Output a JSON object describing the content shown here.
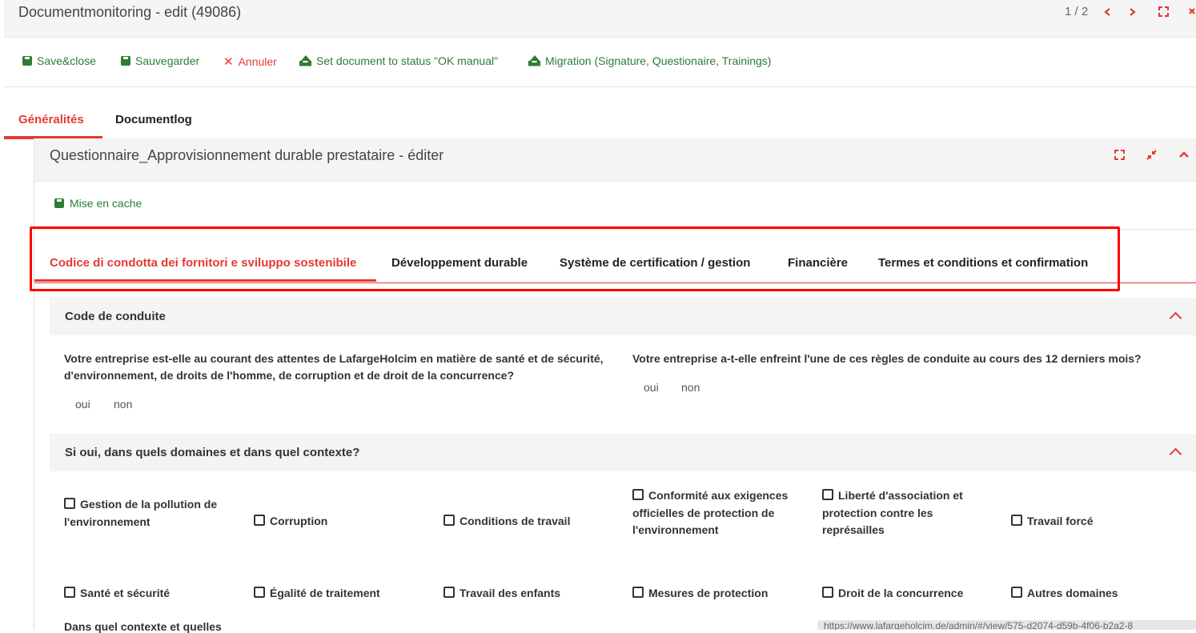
{
  "header": {
    "title": "Documentmonitoring - edit (49086)",
    "pager": "1 / 2",
    "icons": [
      "chevron-left-icon",
      "chevron-right-icon",
      "expand-icon",
      "close-icon"
    ]
  },
  "toolbar": {
    "save_close": "Save&close",
    "save": "Sauvegarder",
    "cancel": "Annuler",
    "set_status": "Set document to status \"OK manual\"",
    "migration": "Migration (Signature, Questionaire, Trainings)"
  },
  "main_tabs": [
    {
      "label": "Généralités",
      "active": true
    },
    {
      "label": "Documentlog",
      "active": false
    }
  ],
  "panel": {
    "title": "Questionnaire_Approvisionnement durable prestataire - éditer",
    "cache_button": "Mise en cache"
  },
  "sub_tabs": [
    {
      "label": "Codice di condotta dei fornitori e sviluppo sostenibile",
      "active": true
    },
    {
      "label": "Développement durable",
      "active": false
    },
    {
      "label": "Système de certification / gestion",
      "active": false
    },
    {
      "label": "Financière",
      "active": false
    },
    {
      "label": "Termes et conditions et confirmation",
      "active": false
    }
  ],
  "sections": {
    "code": {
      "title": "Code de conduite",
      "q1": "Votre entreprise est-elle au courant des attentes de LafargeHolcim en matière de santé et de sécurité, d'environnement, de droits de l'homme, de corruption et de droit de la concurrence?",
      "q2": "Votre entreprise a-t-elle enfreint l'une de ces règles de conduite au cours des 12 derniers mois?",
      "yes": "oui",
      "no": "non"
    },
    "domains": {
      "title": "Si oui, dans quels domaines et dans quel contexte?",
      "checkboxes": [
        "Gestion de la pollution de l'environnement",
        "Corruption",
        "Conditions de travail",
        "Conformité aux exigences officielles de protection de l'environnement",
        "Liberté d'association et protection contre les représailles",
        "Travail forcé",
        "Santé et sécurité",
        "Égalité de traitement",
        "Travail des enfants",
        "Mesures de protection",
        "Droit de la concurrence",
        "Autres domaines"
      ]
    }
  },
  "footer": {
    "partial_label": "Dans quel contexte et quelles",
    "url": "https://www.lafargeholcim.de/admin/#/view/575-d2074-d59b-4f06-b2a2-8"
  },
  "colors": {
    "accent": "#e53935",
    "success": "#2e7d32",
    "highlight": "#ff0000"
  }
}
